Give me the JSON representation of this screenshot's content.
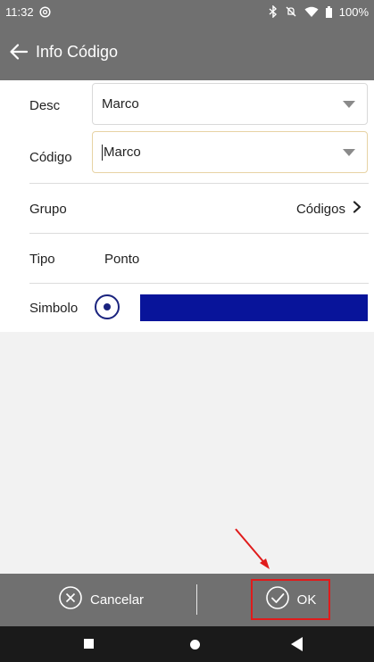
{
  "status_bar": {
    "time": "11:32",
    "battery": "100%",
    "icons": [
      "at-icon",
      "bluetooth-icon",
      "mute-icon",
      "wifi-icon",
      "battery-icon"
    ]
  },
  "app_bar": {
    "title": "Info Código",
    "back_icon": "arrow-left-icon"
  },
  "form": {
    "desc": {
      "label": "Desc",
      "value": "Marco"
    },
    "codigo": {
      "label": "Código",
      "value": "Marco"
    },
    "grupo": {
      "label": "Grupo",
      "value": "Códigos"
    },
    "tipo": {
      "label": "Tipo",
      "value": "Ponto"
    },
    "simbolo": {
      "label": "Simbolo",
      "color": "#08149a"
    }
  },
  "bottom_bar": {
    "cancel_label": "Cancelar",
    "ok_label": "OK",
    "highlight_color": "#e01b1b"
  },
  "colors": {
    "bar": "#707070",
    "accent": "#1a237e",
    "annotation": "#e01b1b"
  }
}
